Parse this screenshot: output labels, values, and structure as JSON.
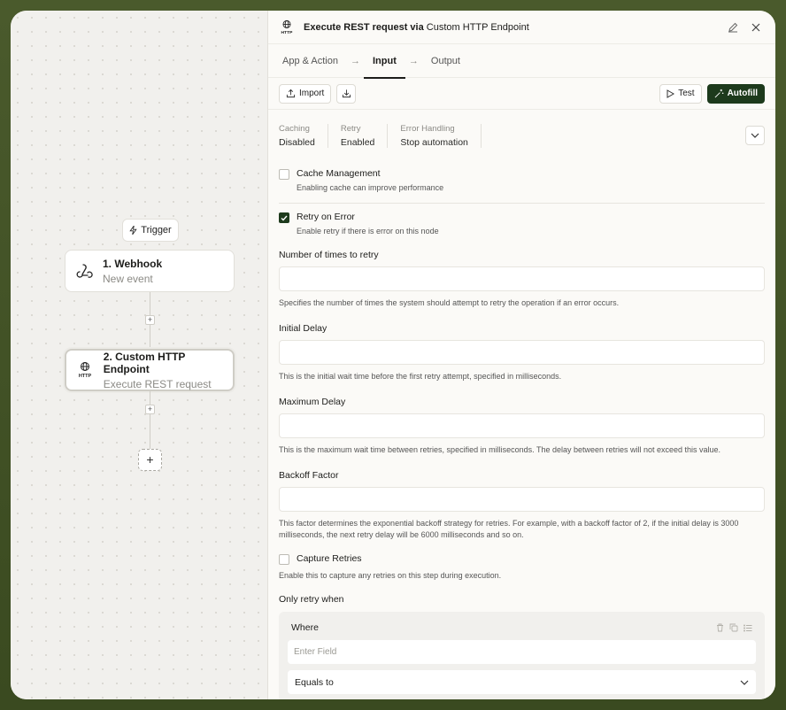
{
  "canvas": {
    "trigger_chip": "Trigger",
    "nodes": [
      {
        "title": "1. Webhook",
        "subtitle": "New event"
      },
      {
        "title": "2. Custom HTTP Endpoint",
        "subtitle": "Execute REST request"
      }
    ],
    "add_symbol": "+"
  },
  "panel": {
    "title_action": "Execute REST request via",
    "title_app": "Custom HTTP Endpoint",
    "tabs": [
      "App & Action",
      "Input",
      "Output"
    ],
    "active_tab": "Input",
    "toolbar": {
      "import": "Import",
      "test": "Test",
      "autofill": "Autofill"
    },
    "summary": [
      {
        "label": "Caching",
        "value": "Disabled"
      },
      {
        "label": "Retry",
        "value": "Enabled"
      },
      {
        "label": "Error Handling",
        "value": "Stop automation"
      }
    ],
    "cache": {
      "title": "Cache Management",
      "desc": "Enabling cache can improve performance",
      "checked": false
    },
    "retry": {
      "title": "Retry on Error",
      "desc": "Enable retry if there is error on this node",
      "checked": true
    },
    "fields": [
      {
        "label": "Number of times to retry",
        "value": "",
        "help": "Specifies the number of times the system should attempt to retry the operation if an error occurs."
      },
      {
        "label": "Initial Delay",
        "value": "",
        "help": "This is the initial wait time before the first retry attempt, specified in milliseconds."
      },
      {
        "label": "Maximum Delay",
        "value": "",
        "help": "This is the maximum wait time between retries, specified in milliseconds. The delay between retries will not exceed this value."
      },
      {
        "label": "Backoff Factor",
        "value": "",
        "help": "This factor determines the exponential backoff strategy for retries. For example, with a backoff factor of 2, if the initial delay is 3000 milliseconds, the next retry delay will be 6000 milliseconds and so on."
      }
    ],
    "capture": {
      "title": "Capture Retries",
      "desc": "Enable this to capture any retries on this step during execution.",
      "checked": false
    },
    "only_retry": {
      "label": "Only retry when",
      "where": "Where",
      "field_placeholder": "Enter Field",
      "operator": "Equals to"
    }
  },
  "colors": {
    "accent": "#1d3a1c",
    "frame": "#4a5a2c"
  }
}
